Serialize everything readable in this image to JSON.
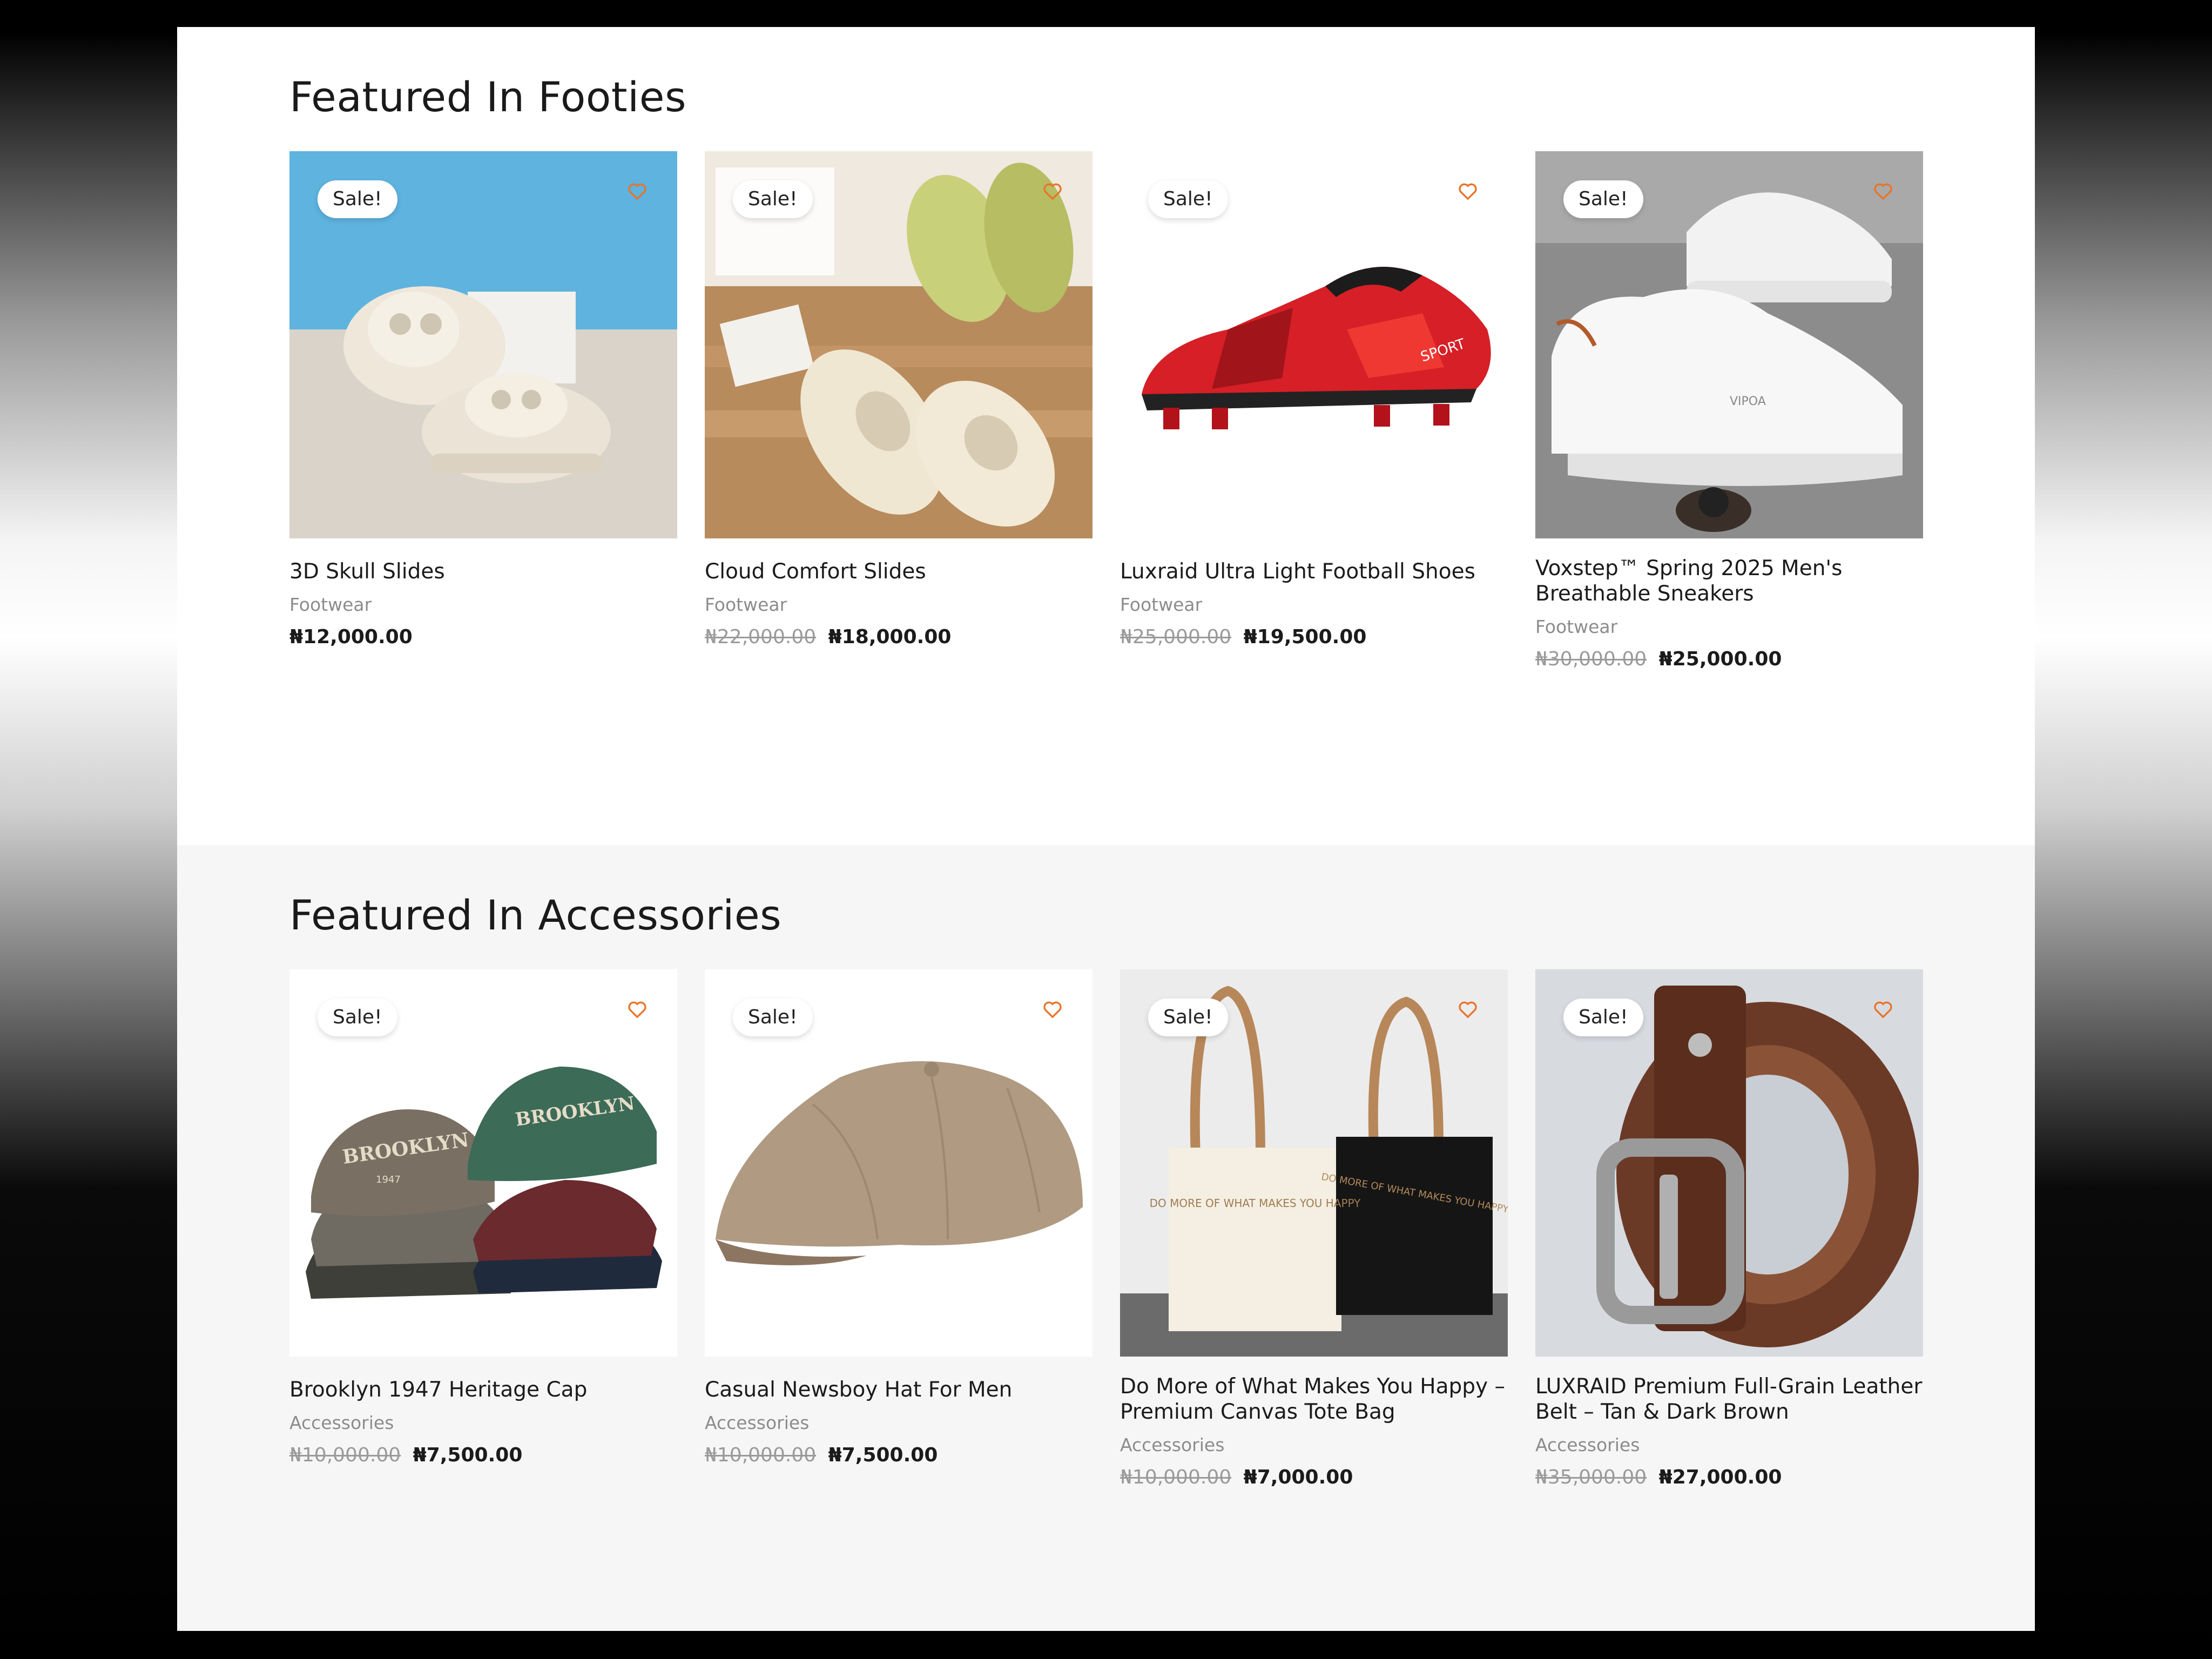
{
  "sections": [
    {
      "title": "Featured In Footies",
      "products": [
        {
          "name": "3D Skull Slides",
          "category": "Footwear",
          "old_price": "",
          "price": "₦12,000.00",
          "badge": "Sale!",
          "wishlist_icon": "heart-icon"
        },
        {
          "name": "Cloud Comfort Slides",
          "category": "Footwear",
          "old_price": "₦22,000.00",
          "price": "₦18,000.00",
          "badge": "Sale!",
          "wishlist_icon": "heart-icon"
        },
        {
          "name": "Luxraid Ultra Light Football Shoes",
          "category": "Footwear",
          "old_price": "₦25,000.00",
          "price": "₦19,500.00",
          "badge": "Sale!",
          "wishlist_icon": "heart-icon"
        },
        {
          "name": "Voxstep™ Spring 2025 Men's Breathable Sneakers",
          "category": "Footwear",
          "old_price": "₦30,000.00",
          "price": "₦25,000.00",
          "badge": "Sale!",
          "wishlist_icon": "heart-icon"
        }
      ]
    },
    {
      "title": "Featured In Accessories",
      "products": [
        {
          "name": "Brooklyn 1947 Heritage Cap",
          "category": "Accessories",
          "old_price": "₦10,000.00",
          "price": "₦7,500.00",
          "badge": "Sale!",
          "wishlist_icon": "heart-icon"
        },
        {
          "name": "Casual Newsboy Hat For Men",
          "category": "Accessories",
          "old_price": "₦10,000.00",
          "price": "₦7,500.00",
          "badge": "Sale!",
          "wishlist_icon": "heart-icon"
        },
        {
          "name": "Do More of What Makes You Happy – Premium Canvas Tote Bag",
          "category": "Accessories",
          "old_price": "₦10,000.00",
          "price": "₦7,000.00",
          "badge": "Sale!",
          "wishlist_icon": "heart-icon",
          "print_text": "DO MORE OF WHAT MAKES YOU HAPPY"
        },
        {
          "name": "LUXRAID Premium Full-Grain Leather Belt – Tan & Dark Brown",
          "category": "Accessories",
          "old_price": "₦35,000.00",
          "price": "₦27,000.00",
          "badge": "Sale!",
          "wishlist_icon": "heart-icon"
        }
      ]
    }
  ],
  "image_text": {
    "cap": "BROOKLYN",
    "cap_year": "1947",
    "shoe": "SPORT",
    "sneaker": "VIPOA"
  },
  "colors": {
    "accent": "#e8742b",
    "sale_old": "#9a9a9a",
    "section_alt_bg": "#f6f6f6"
  }
}
